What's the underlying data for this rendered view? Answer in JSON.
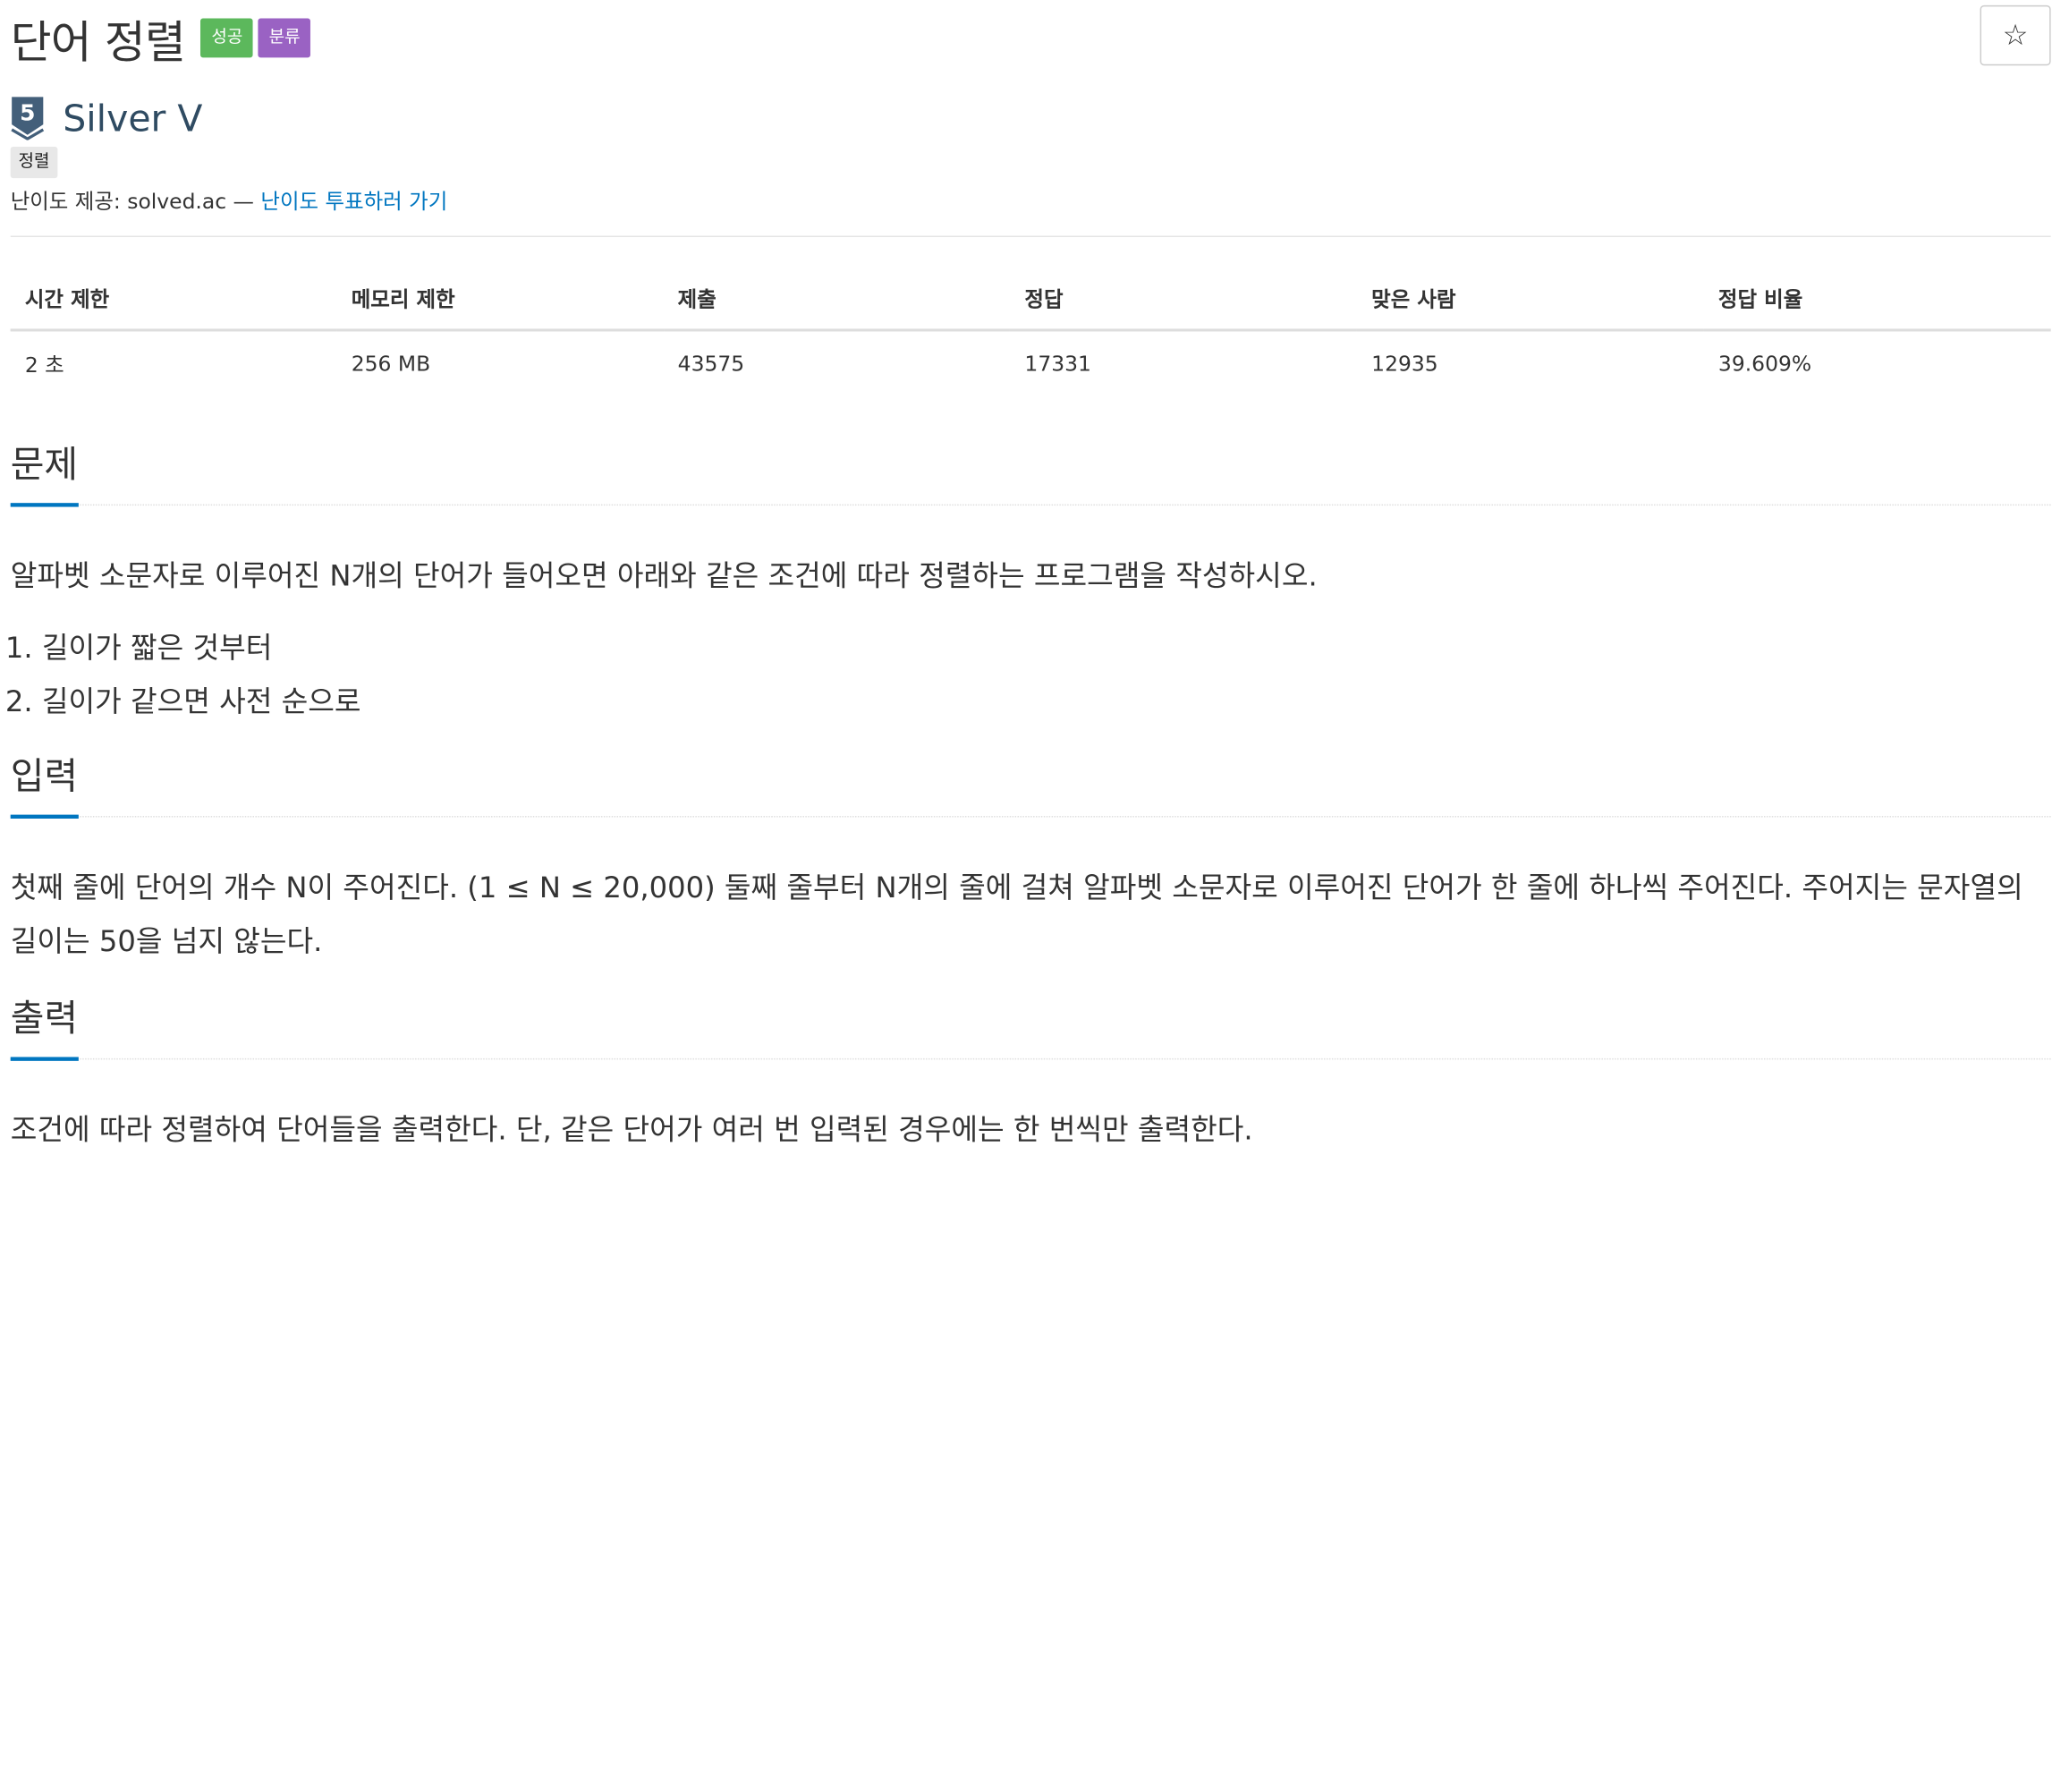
{
  "problem": {
    "title": "단어 정렬",
    "badges": {
      "result": "성공",
      "class": "분류"
    }
  },
  "tier": {
    "number": "5",
    "name": "Silver V"
  },
  "tags": [
    "정렬"
  ],
  "credit": {
    "prefix": "난이도 제공: solved.ac — ",
    "link_label": "난이도 투표하러 가기"
  },
  "star_button": {
    "icon": "star-icon",
    "glyph": "☆"
  },
  "info_table": {
    "headers": [
      "시간 제한",
      "메모리 제한",
      "제출",
      "정답",
      "맞은 사람",
      "정답 비율"
    ],
    "row": [
      "2 초",
      "256 MB",
      "43575",
      "17331",
      "12935",
      "39.609%"
    ]
  },
  "sections": {
    "description": {
      "title": "문제",
      "text": "알파벳 소문자로 이루어진 N개의 단어가 들어오면 아래와 같은 조건에 따라 정렬하는 프로그램을 작성하시오.",
      "items": [
        "길이가 짧은 것부터",
        "길이가 같으면 사전 순으로"
      ]
    },
    "input": {
      "title": "입력",
      "text": "첫째 줄에 단어의 개수 N이 주어진다. (1 ≤ N ≤ 20,000) 둘째 줄부터 N개의 줄에 걸쳐 알파벳 소문자로 이루어진 단어가 한 줄에 하나씩 주어진다. 주어지는 문자열의 길이는 50을 넘지 않는다."
    },
    "output": {
      "title": "출력",
      "text": "조건에 따라 정렬하여 단어들을 출력한다. 단, 같은 단어가 여러 번 입력된 경우에는 한 번씩만 출력한다."
    }
  },
  "colors": {
    "success_badge": "#5cb85c",
    "class_badge": "#9a62c3",
    "tier_silver": "#435f7a",
    "link": "#0076c0",
    "section_underline": "#0076c0"
  }
}
